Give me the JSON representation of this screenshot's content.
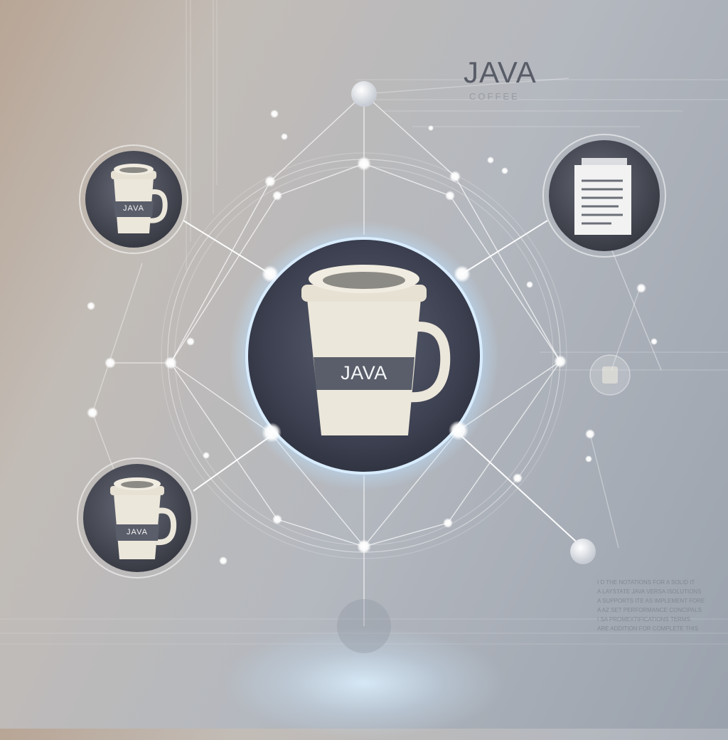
{
  "brand": {
    "title": "JAVA",
    "subtitle": "COFFEE"
  },
  "center_node": {
    "label": "JAVA",
    "icon": "coffee-cup-icon"
  },
  "side_nodes": [
    {
      "icon": "coffee-cup-icon",
      "label": "JAVA"
    },
    {
      "icon": "document-icon"
    },
    {
      "icon": "coffee-cup-icon",
      "label": "JAVA"
    }
  ],
  "text_block": {
    "lines": [
      "I D THE NOTATIONS FOR A SOLID IT",
      "A LAYSTATE JAVA VERSA ISOLUTIONS",
      "A SUPPORTS ITE AS IMPLEMENT FORE",
      "A AZ SET PERFORMANCE CONCIPALS",
      "I SA PROMEXTIFICATIONS TERMS",
      "ARE ADDITION FOR COMPLETE THIS"
    ]
  },
  "colors": {
    "accent": "#8fc4ff",
    "node_fill": "#4a4e5c",
    "cup": "#ece7db"
  }
}
